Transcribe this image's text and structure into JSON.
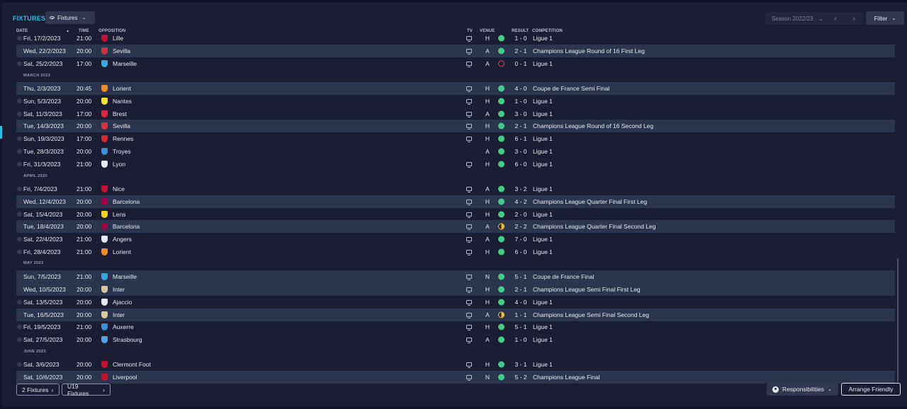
{
  "header": {
    "title": "FIXTURES",
    "view_label": "Fixtures",
    "season_label": "Season 2022/23",
    "filter_label": "Filter"
  },
  "columns": {
    "date": "DATE",
    "time": "TIME",
    "opposition": "OPPOSITION",
    "tv": "TV",
    "venue": "VENUE",
    "result": "RESULT",
    "competition": "COMPETITION"
  },
  "months": [
    "MARCH 2023",
    "APRIL 2023",
    "MAY 2023",
    "JUNE 2023"
  ],
  "rows": [
    {
      "date": "Fri, 17/2/2023",
      "time": "21:00",
      "opp": "Lille",
      "crest": "#c8102e",
      "tv": true,
      "venue": "H",
      "res": "win",
      "score": "1 - 0",
      "comp": "Ligue 1"
    },
    {
      "date": "Wed, 22/2/2023",
      "time": "20:00",
      "opp": "Sevilla",
      "crest": "#d6323a",
      "tv": true,
      "venue": "A",
      "res": "win",
      "score": "2 - 1",
      "comp": "Champions League Round of 16  First Leg"
    },
    {
      "date": "Sat, 25/2/2023",
      "time": "17:00",
      "opp": "Marseille",
      "crest": "#36a8e0",
      "tv": true,
      "venue": "A",
      "res": "loss",
      "score": "0 - 1",
      "comp": "Ligue 1"
    },
    {
      "date": "Thu, 2/3/2023",
      "time": "20:45",
      "opp": "Lorient",
      "crest": "#f08a24",
      "tv": true,
      "venue": "H",
      "res": "win",
      "score": "4 - 0",
      "comp": "Coupe de France Semi Final"
    },
    {
      "date": "Sun, 5/3/2023",
      "time": "20:00",
      "opp": "Nantes",
      "crest": "#f5e52a",
      "tv": true,
      "venue": "H",
      "res": "win",
      "score": "1 - 0",
      "comp": "Ligue 1"
    },
    {
      "date": "Sat, 11/3/2023",
      "time": "17:00",
      "opp": "Brest",
      "crest": "#e0283c",
      "tv": true,
      "venue": "A",
      "res": "win",
      "score": "3 - 0",
      "comp": "Ligue 1"
    },
    {
      "date": "Tue, 14/3/2023",
      "time": "20:00",
      "opp": "Sevilla",
      "crest": "#d6323a",
      "tv": true,
      "venue": "H",
      "res": "win",
      "score": "2 - 1",
      "comp": "Champions League Round of 16  Second Leg"
    },
    {
      "date": "Sun, 19/3/2023",
      "time": "17:00",
      "opp": "Rennes",
      "crest": "#d22630",
      "tv": true,
      "venue": "H",
      "res": "win",
      "score": "6 - 1",
      "comp": "Ligue 1"
    },
    {
      "date": "Tue, 28/3/2023",
      "time": "20:00",
      "opp": "Troyes",
      "crest": "#3a8fd6",
      "tv": false,
      "venue": "A",
      "res": "win",
      "score": "3 - 0",
      "comp": "Ligue 1"
    },
    {
      "date": "Fri, 31/3/2023",
      "time": "21:00",
      "opp": "Lyon",
      "crest": "#e8e8f0",
      "tv": true,
      "venue": "H",
      "res": "win",
      "score": "6 - 0",
      "comp": "Ligue 1"
    },
    {
      "date": "Fri, 7/4/2023",
      "time": "21:00",
      "opp": "Nice",
      "crest": "#c8102e",
      "tv": true,
      "venue": "A",
      "res": "win",
      "score": "3 - 2",
      "comp": "Ligue 1"
    },
    {
      "date": "Wed, 12/4/2023",
      "time": "20:00",
      "opp": "Barcelona",
      "crest": "#a50044",
      "tv": true,
      "venue": "H",
      "res": "win",
      "score": "4 - 2",
      "comp": "Champions League Quarter Final First Leg"
    },
    {
      "date": "Sat, 15/4/2023",
      "time": "20:00",
      "opp": "Lens",
      "crest": "#f7d117",
      "tv": true,
      "venue": "H",
      "res": "win",
      "score": "2 - 0",
      "comp": "Ligue 1"
    },
    {
      "date": "Tue, 18/4/2023",
      "time": "20:00",
      "opp": "Barcelona",
      "crest": "#a50044",
      "tv": true,
      "venue": "A",
      "res": "draw",
      "score": "2 - 2",
      "comp": "Champions League Quarter Final Second Leg"
    },
    {
      "date": "Sat, 22/4/2023",
      "time": "21:00",
      "opp": "Angers",
      "crest": "#e8e8f0",
      "tv": true,
      "venue": "A",
      "res": "win",
      "score": "7 - 0",
      "comp": "Ligue 1"
    },
    {
      "date": "Fri, 28/4/2023",
      "time": "21:00",
      "opp": "Lorient",
      "crest": "#f08a24",
      "tv": true,
      "venue": "H",
      "res": "win",
      "score": "6 - 0",
      "comp": "Ligue 1"
    },
    {
      "date": "Sun, 7/5/2023",
      "time": "21:00",
      "opp": "Marseille",
      "crest": "#36a8e0",
      "tv": true,
      "venue": "N",
      "res": "win",
      "score": "5 - 1",
      "comp": "Coupe de France Final"
    },
    {
      "date": "Wed, 10/5/2023",
      "time": "20:00",
      "opp": "Inter",
      "crest": "#d9c89a",
      "tv": true,
      "venue": "H",
      "res": "win",
      "score": "2 - 1",
      "comp": "Champions League Semi Final First Leg"
    },
    {
      "date": "Sat, 13/5/2023",
      "time": "20:00",
      "opp": "Ajaccio",
      "crest": "#e8e8f0",
      "tv": true,
      "venue": "H",
      "res": "win",
      "score": "4 - 0",
      "comp": "Ligue 1"
    },
    {
      "date": "Tue, 16/5/2023",
      "time": "20:00",
      "opp": "Inter",
      "crest": "#d9c89a",
      "tv": true,
      "venue": "A",
      "res": "draw",
      "score": "1 - 1",
      "comp": "Champions League Semi Final Second Leg"
    },
    {
      "date": "Fri, 19/5/2023",
      "time": "21:00",
      "opp": "Auxerre",
      "crest": "#3a8fd6",
      "tv": true,
      "venue": "H",
      "res": "win",
      "score": "5 - 1",
      "comp": "Ligue 1"
    },
    {
      "date": "Sat, 27/5/2023",
      "time": "20:00",
      "opp": "Strasbourg",
      "crest": "#4aa8e8",
      "tv": true,
      "venue": "A",
      "res": "win",
      "score": "1 - 0",
      "comp": "Ligue 1"
    },
    {
      "date": "Sat, 3/6/2023",
      "time": "20:00",
      "opp": "Clermont Foot",
      "crest": "#c8102e",
      "tv": true,
      "venue": "H",
      "res": "win",
      "score": "3 - 1",
      "comp": "Ligue 1"
    },
    {
      "date": "Sat, 10/6/2023",
      "time": "20:00",
      "opp": "Liverpool",
      "crest": "#c8102e",
      "tv": true,
      "venue": "N",
      "res": "win",
      "score": "5 - 2",
      "comp": "Champions League Final"
    }
  ],
  "footer": {
    "fixtures_count_label": "2 Fixtures",
    "u19_label": "U19 Fixtures",
    "responsibilities_label": "Responsibilities",
    "arrange_label": "Arrange Friendly"
  },
  "colors": {
    "accent": "#2bbfe8",
    "win": "#3fcf84",
    "loss": "#e0445c",
    "draw": "#f1b93a",
    "highlight_row": "#2b3550",
    "background": "#1b1d33"
  }
}
